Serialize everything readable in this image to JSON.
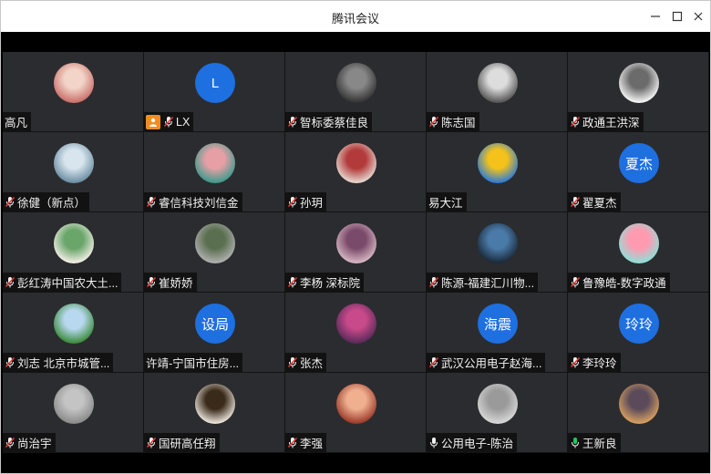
{
  "window": {
    "title": "腾讯会议",
    "min_icon": "minimize-icon",
    "max_icon": "maximize-icon",
    "close_icon": "close-icon"
  },
  "colors": {
    "tile_bg": "#2b2c2f",
    "text_avatar_bg": "#1e6fe0",
    "host_badge": "#f08c22",
    "mic_muted": "#e53935",
    "mic_active": "#22c55e"
  },
  "participants": [
    {
      "name": "高凡",
      "avatar": "photo",
      "mic": "none"
    },
    {
      "name": "LX",
      "avatar": "L",
      "mic": "muted",
      "host": true
    },
    {
      "name": "智标委蔡佳良",
      "avatar": "photo",
      "mic": "muted"
    },
    {
      "name": "陈志国",
      "avatar": "photo",
      "mic": "muted"
    },
    {
      "name": "政通王洪深",
      "avatar": "photo",
      "mic": "muted"
    },
    {
      "name": "徐健（新点）",
      "avatar": "photo",
      "mic": "muted"
    },
    {
      "name": "睿信科技刘信金",
      "avatar": "photo",
      "mic": "muted"
    },
    {
      "name": "孙玥",
      "avatar": "photo",
      "mic": "muted"
    },
    {
      "name": "易大江",
      "avatar": "photo",
      "mic": "none"
    },
    {
      "name": "翟夏杰",
      "avatar": "夏杰",
      "mic": "muted"
    },
    {
      "name": "彭红涛中国农大土...",
      "avatar": "photo",
      "mic": "muted"
    },
    {
      "name": "崔娇娇",
      "avatar": "photo",
      "mic": "muted"
    },
    {
      "name": "李杨 深标院",
      "avatar": "photo",
      "mic": "muted"
    },
    {
      "name": "陈源-福建汇川物...",
      "avatar": "photo",
      "mic": "muted"
    },
    {
      "name": "鲁豫皓-数字政通",
      "avatar": "photo",
      "mic": "muted"
    },
    {
      "name": "刘志 北京市城管...",
      "avatar": "photo",
      "mic": "muted"
    },
    {
      "name": "许靖-宁国市住房...",
      "avatar": "设局",
      "mic": "none"
    },
    {
      "name": "张杰",
      "avatar": "photo",
      "mic": "muted"
    },
    {
      "name": "武汉公用电子赵海...",
      "avatar": "海震",
      "mic": "muted"
    },
    {
      "name": "李玲玲",
      "avatar": "玲玲",
      "mic": "muted"
    },
    {
      "name": "尚治宇",
      "avatar": "photo",
      "mic": "muted"
    },
    {
      "name": "国研高任翔",
      "avatar": "photo",
      "mic": "muted"
    },
    {
      "name": "李强",
      "avatar": "photo",
      "mic": "muted"
    },
    {
      "name": "公用电子-陈治",
      "avatar": "photo",
      "mic": "on"
    },
    {
      "name": "王新良",
      "avatar": "photo",
      "mic": "active"
    }
  ]
}
